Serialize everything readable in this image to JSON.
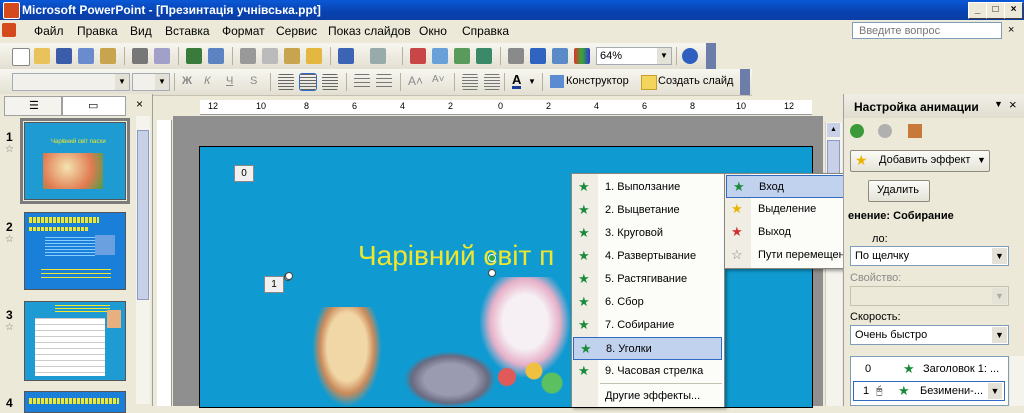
{
  "window": {
    "title": "Microsoft PowerPoint - [Презинтація учнівська.ppt]"
  },
  "menubar": {
    "items": [
      "Файл",
      "Правка",
      "Вид",
      "Вставка",
      "Формат",
      "Сервис",
      "Показ слайдов",
      "Окно",
      "Справка"
    ],
    "help_placeholder": "Введите вопрос"
  },
  "toolbar": {
    "zoom": "64%",
    "designer_label": "Конструктор",
    "new_slide_label": "Создать слайд"
  },
  "slides_pane": {
    "numbers": [
      "1",
      "2",
      "3",
      "4"
    ],
    "thumb1_title": "Чарівний світ пасхи"
  },
  "ruler": {
    "ticks": [
      "12",
      "10",
      "8",
      "6",
      "4",
      "2",
      "0",
      "2",
      "4",
      "6",
      "8",
      "10",
      "12"
    ]
  },
  "slide": {
    "title": "Чарівний світ п",
    "tag0": "0",
    "tag1": "1"
  },
  "entrance_menu": {
    "items": [
      "1. Выползание",
      "2. Выцветание",
      "3. Круговой",
      "4. Развертывание",
      "5. Растягивание",
      "6. Сбор",
      "7. Собирание",
      "8. Уголки",
      "9. Часовая стрелка",
      "Другие эффекты..."
    ],
    "selected_index": 7
  },
  "effect_menu": {
    "items": [
      "Вход",
      "Выделение",
      "Выход",
      "Пути перемещения"
    ],
    "selected_index": 0
  },
  "taskpane": {
    "title": "Настройка анимации",
    "add_effect": "Добавить эффект",
    "delete": "Удалить",
    "change_label": "енение: Собирание",
    "start_label": "ло:",
    "start_value": "По щелчку",
    "property_label": "Свойство:",
    "speed_label": "Скорость:",
    "speed_value": "Очень быстро",
    "list": [
      {
        "num": "0",
        "name": "Заголовок 1: ..."
      },
      {
        "num": "1",
        "name": "Безимени-..."
      }
    ]
  },
  "colors": {
    "slide_bg": "#0f9bd1",
    "title_text": "#f0e62d",
    "titlebar": "#0a58d6"
  }
}
